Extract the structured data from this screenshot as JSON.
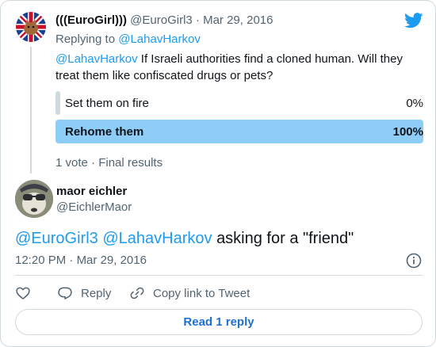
{
  "parent_tweet": {
    "display_name": "(((EuroGirl)))",
    "handle": "@EuroGirl3",
    "separator": "·",
    "date": "Mar 29, 2016",
    "replying_prefix": "Replying to",
    "replying_to": "@LahavHarkov",
    "text_mention": "@LahavHarkov",
    "text": "If Israeli authorities find a cloned human. Will they treat them like confiscated drugs or pets?",
    "poll": {
      "options": [
        {
          "label": "Set them on fire",
          "percent_label": "0%",
          "percent": 0
        },
        {
          "label": "Rehome them",
          "percent_label": "100%",
          "percent": 100
        }
      ],
      "votes": "1 vote",
      "separator": "·",
      "status": "Final results"
    }
  },
  "reply_tweet": {
    "display_name": "maor eichler",
    "handle": "@EichlerMaor",
    "mention1": "@EuroGirl3",
    "mention2": "@LahavHarkov",
    "text": "asking for a \"friend\"",
    "time": "12:20 PM",
    "separator": "·",
    "date": "Mar 29, 2016"
  },
  "actions": {
    "reply_label": "Reply",
    "copy_label": "Copy link to Tweet",
    "read_replies_label": "Read 1 reply"
  },
  "icons": {
    "brand": "twitter-bird-icon",
    "info": "info-icon",
    "like": "heart-icon",
    "reply": "speech-bubble-icon",
    "copy": "link-icon"
  },
  "colors": {
    "accent": "#1d9bf0",
    "poll_winner": "#8ecdf7",
    "muted": "#536471",
    "border": "#cfd9de"
  }
}
